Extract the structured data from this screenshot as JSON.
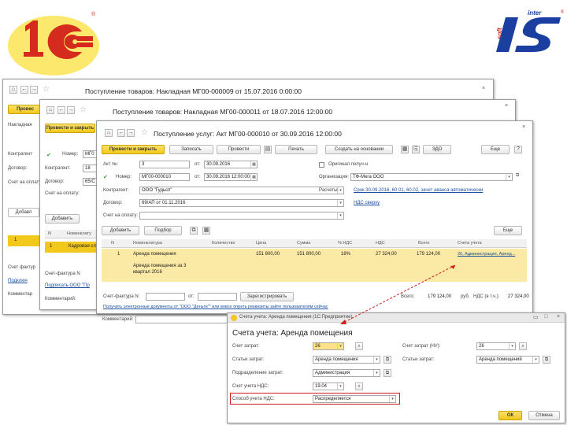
{
  "logo_1c": {
    "text": "1C"
  },
  "logo_intersoft": {
    "top": "inter",
    "bottom": "soft",
    "letters": "IS",
    "mark": "®"
  },
  "windows": {
    "w1": {
      "title": "Поступление товаров: Накладная МГ00-000009 от 15.07.2016 0:00:00",
      "btn_post": "Провес",
      "labels": [
        "Накладная",
        "Контрагент",
        "Договор:",
        "Счет на оплату:"
      ],
      "tab": "Добавл",
      "row_num": "1",
      "invoice": "Счет фактур",
      "link": "Подключ",
      "comment": "Комментар"
    },
    "w2": {
      "title": "Поступление товаров: Накладная МГ00-000011 от 18.07.2016 12:00:00",
      "btn_post": "Провести и закрыть",
      "labels": [
        "Номер:",
        "Контрагент:",
        "Договор:",
        "Счет на оплату:"
      ],
      "field_number": "МГ0",
      "field_date": "18",
      "field_contract": "65/С",
      "add": "Добавить",
      "col_n": "N",
      "col_item": "Номенклату",
      "row_num": "1",
      "row_item": "Кадровая сл",
      "invoice": "Счет-фактура N",
      "link": "Подписать ООО \"Пр",
      "comment": "Комментарий:"
    },
    "w3": {
      "title": "Поступление услуг: Акт МГ00-000010 от 30.09.2016 12:00:00",
      "toolbar": {
        "post_close": "Провести и закрыть",
        "save": "Записать",
        "post": "Провести",
        "print": "Печать",
        "create_based": "Создать на основании",
        "edo": "ЭДО",
        "more": "Еще"
      },
      "act_no_label": "Акт №:",
      "act_no": "3",
      "act_date_label": "от:",
      "act_date": "30.09.2016",
      "number_label": "Номер:",
      "number": "МГ00-000010",
      "number_date": "30.09.2016 12:00:00",
      "original_label": "Оригинал получ-н",
      "org_label": "Организация:",
      "org": "ТФ-Мега ООО",
      "counterparty_label": "Контрагент:",
      "counterparty": "ООО \"Гудьсп\"",
      "settlements_label": "Расчеты:",
      "settlements_link": "Срок 30.09.2016, 60.01, 60.02, зачет аванса автоматически",
      "contract_label": "Договор:",
      "contract": "69/АП от 01.11.2016",
      "vat_link": "НДС сверху",
      "invoice_label": "Счет на оплату:",
      "add": "Добавить",
      "pick": "Подбор",
      "more2": "Еще",
      "columns": [
        "N",
        "Номенклатура",
        "Количество",
        "Цена",
        "Сумма",
        "% НДС",
        "НДС",
        "Всего",
        "Счета учета"
      ],
      "row": {
        "n": "1",
        "item": "Аренда помещения",
        "qty": "",
        "price": "151 800,00",
        "sum": "151 800,00",
        "vat_pct": "18%",
        "vat": "27 324,00",
        "total": "179 124,00",
        "account": "26, Администрация, Аренд..."
      },
      "row_desc": "Аренда помещения за 3 квартал 2016",
      "invoice_text_label": "Счет-фактура N:",
      "invoice_from": "от:",
      "register_btn": "Зарегистрировать",
      "total_label": "Всего:",
      "total": "179 124,00",
      "currency": "руб.",
      "vat_total_label": "НДС (в т.ч.):",
      "vat_total": "27 324,00",
      "edo_link": "Получить электронные документы от \"ООО \"Деньги\"\" или вовсе опреть реквизиты зайте пользователям сейчас",
      "comment_label": "Комментарий:"
    },
    "dialog": {
      "window_title": "Счета учета: Аренда помещения (1С:Предприятие)",
      "heading": "Счета учета: Аренда помещения",
      "cost_account_label": "Счет затрат:",
      "cost_account": "26",
      "cost_account_nu_label": "Счет затрат (НУ):",
      "cost_account_nu": "26",
      "cost_item_label": "Статьи затрат:",
      "cost_item": "Аренда помещения",
      "cost_item2_label": "Статьи затрат:",
      "cost_item2": "Аренда помещений",
      "department_label": "Подразделение затрат:",
      "department": "Администрация",
      "vat_account_label": "Счет учета НДС:",
      "vat_account": "19.04",
      "vat_method_label": "Способ учета НДС:",
      "vat_method": "Распределяется",
      "ok": "ОК",
      "cancel": "Отмена"
    }
  },
  "colors": {
    "accent_yellow": "#f2c81b",
    "row_highlight": "#fbe9a6",
    "link_blue": "#1a4fa0",
    "arrow_red": "#d01c1c",
    "logo_red": "#d52b1e"
  }
}
